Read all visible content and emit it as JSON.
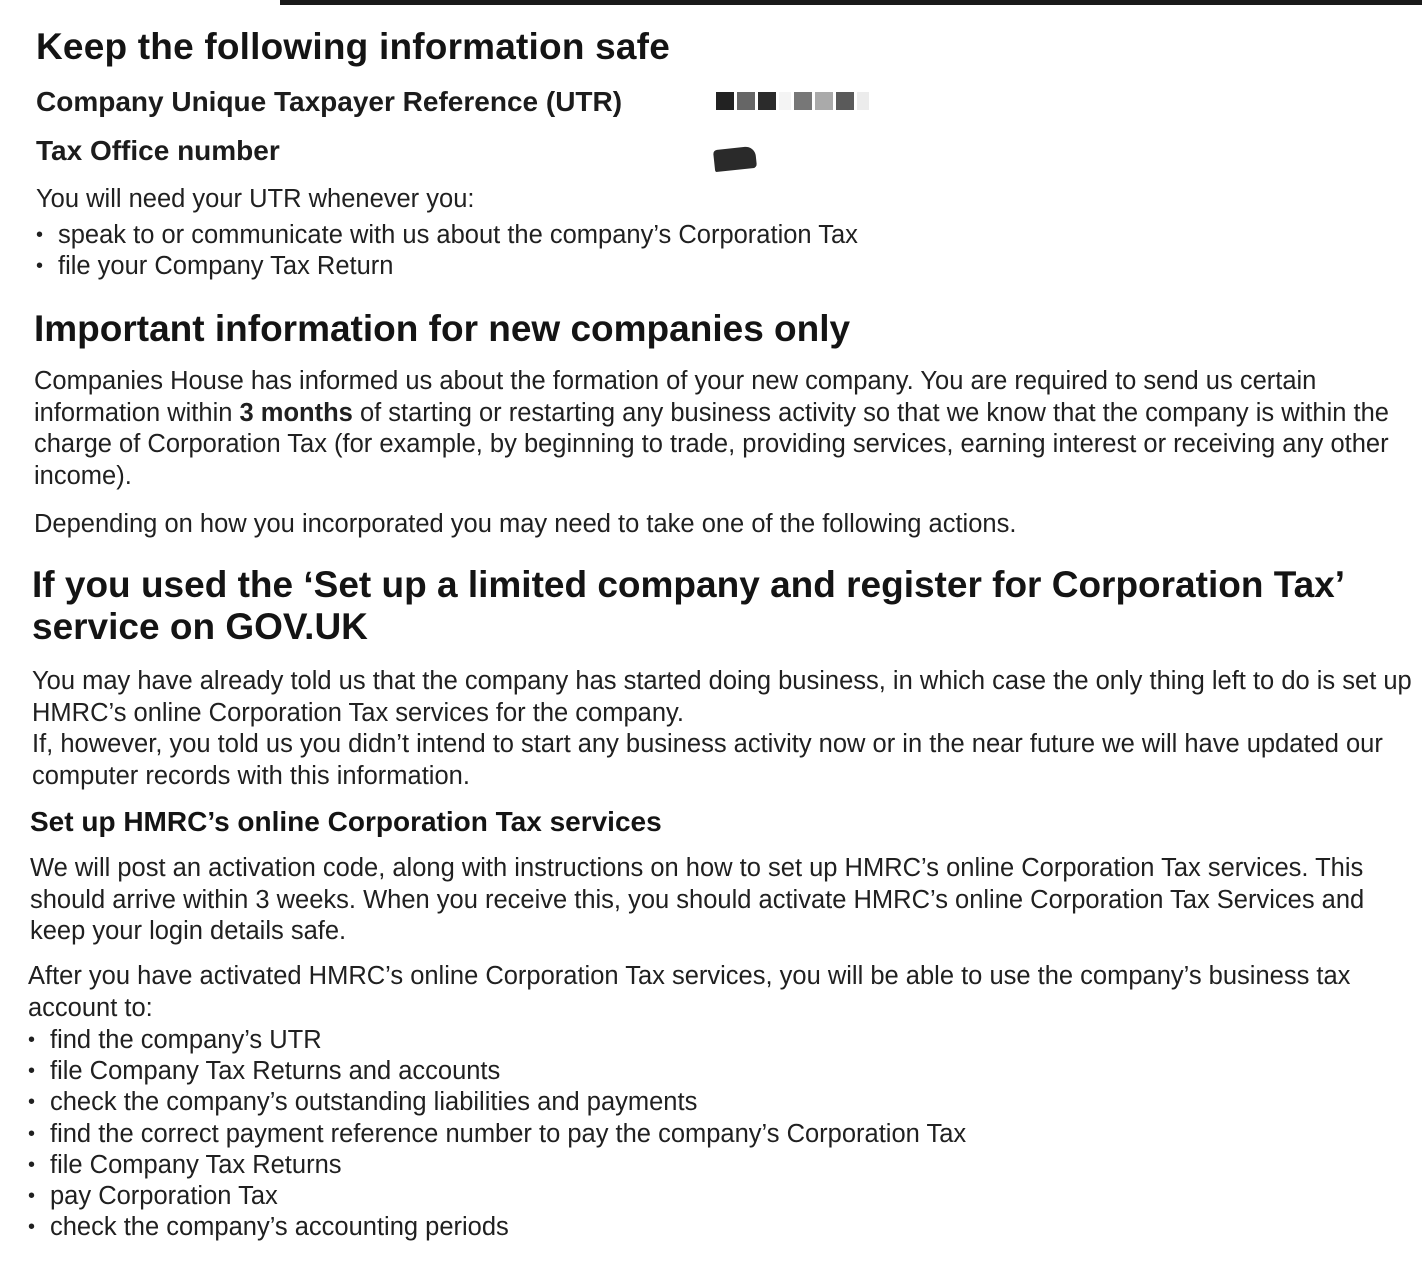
{
  "section_keep": {
    "heading": "Keep the following information safe",
    "utr_label": "Company Unique Taxpayer Reference (UTR)",
    "office_label": "Tax Office number",
    "need_utr_intro": "You will need your UTR whenever you:",
    "need_utr_items": [
      "speak to or communicate with us about the company’s Corporation Tax",
      "file your Company Tax Return"
    ]
  },
  "section_new": {
    "heading": "Important information for new companies only",
    "para1_before": "Companies House has informed us about the formation of your new company. You are required to send us certain information within ",
    "para1_bold": "3 months",
    "para1_after": " of starting or restarting any business activity so that we know that the company is within the charge of Corporation Tax (for example, by beginning to trade, providing services, earning interest or receiving any other income).",
    "para2": "Depending on how you incorporated you may need to take one of the following actions."
  },
  "section_govuk": {
    "heading": "If you used the ‘Set up a limited company and register for Corporation Tax’ service on GOV.UK",
    "para1": "You may have already told us that the company has started doing business, in which case the only thing left to do is set up HMRC’s online Corporation Tax services for the company.",
    "para2": "If, however, you told us you didn’t intend to start any business activity now or in the near future we will have updated our computer records with this information."
  },
  "section_setup": {
    "heading": "Set up HMRC’s online Corporation Tax services",
    "para1": "We will post an activation code, along with instructions on how to set up HMRC’s online Corporation Tax services. This should arrive within 3 weeks. When you receive this, you should activate HMRC’s online Corporation Tax Services and keep your login details safe.",
    "para2": "After you have activated HMRC’s online Corporation Tax services, you will be able to use the company’s business tax account to:",
    "items": [
      "find the company’s UTR",
      "file Company Tax Returns and accounts",
      "check the company’s outstanding liabilities and payments",
      "find the correct payment reference number to pay the company’s Corporation Tax",
      "file Company Tax Returns",
      "pay Corporation Tax",
      "check the company’s accounting periods"
    ]
  },
  "colors": {
    "text": "#202020",
    "redaction": "#2a2a2a"
  }
}
